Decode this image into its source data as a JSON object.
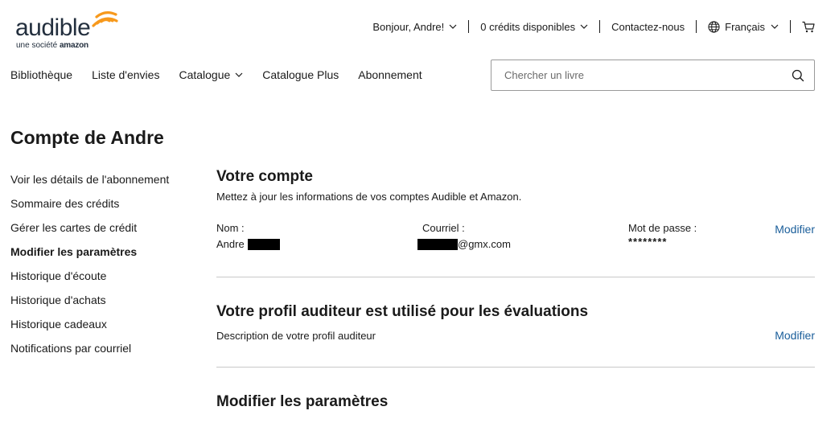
{
  "brand": {
    "name": "audible",
    "tagline_prefix": "une société",
    "tagline_brand": "amazon",
    "accent_color": "#f7991c"
  },
  "topbar": {
    "greeting": "Bonjour, Andre!",
    "credits": "0 crédits disponibles",
    "contact": "Contactez-nous",
    "language": "Français"
  },
  "mainnav": {
    "items": [
      "Bibliothèque",
      "Liste d'envies",
      "Catalogue",
      "Catalogue Plus",
      "Abonnement"
    ]
  },
  "search": {
    "placeholder": "Chercher un livre"
  },
  "page": {
    "title": "Compte de Andre"
  },
  "sidenav": {
    "items": [
      "Voir les détails de l'abonnement",
      "Sommaire des crédits",
      "Gérer les cartes de crédit",
      "Modifier les paramètres",
      "Historique d'écoute",
      "Historique d'achats",
      "Historique cadeaux",
      "Notifications par courriel"
    ],
    "active": "Modifier les paramètres"
  },
  "account": {
    "title": "Votre compte",
    "description": "Mettez à jour les informations de vos comptes Audible et Amazon.",
    "name_label": "Nom :",
    "name_value": "Andre",
    "email_label": "Courriel :",
    "email_value": "@gmx.com",
    "password_label": "Mot de passe :",
    "password_value": "********",
    "modify_label": "Modifier"
  },
  "profile": {
    "title": "Votre profil auditeur est utilisé pour les évaluations",
    "description": "Description de votre profil auditeur",
    "modify_label": "Modifier"
  },
  "settings": {
    "title": "Modifier les paramètres"
  },
  "colors": {
    "link": "#1a5e9a",
    "divider": "#c8c8c8",
    "text": "#1a1a1a"
  },
  "icons": [
    "audible-logo-waves",
    "chevron-down-icon",
    "globe-icon",
    "cart-icon",
    "search-icon"
  ]
}
